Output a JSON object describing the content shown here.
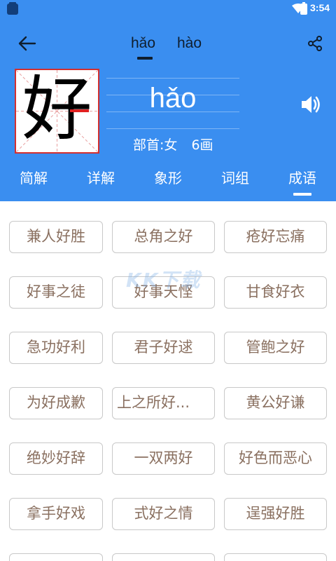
{
  "status_bar": {
    "time": "3:54",
    "icons": [
      "app-icon",
      "wifi-icon",
      "battery-icon"
    ]
  },
  "header": {
    "pinyin_tabs": [
      {
        "label": "hǎo",
        "selected": true
      },
      {
        "label": "hào",
        "selected": false
      }
    ],
    "character": "好",
    "pinyin": "hǎo",
    "radical_label": "部首:女",
    "stroke_count_label": "6画",
    "colors": {
      "background": "#3a8ef0",
      "char_border": "#d33030",
      "highlight_stroke": "#e02020"
    }
  },
  "tabs": [
    {
      "label": "简解",
      "selected": false
    },
    {
      "label": "详解",
      "selected": false
    },
    {
      "label": "象形",
      "selected": false
    },
    {
      "label": "词组",
      "selected": false
    },
    {
      "label": "成语",
      "selected": true
    }
  ],
  "idioms": [
    "兼人好胜",
    "总角之好",
    "疮好忘痛",
    "好事之徒",
    "好事天悭",
    "甘食好衣",
    "急功好利",
    "君子好逑",
    "管鲍之好",
    "为好成歉",
    "上之所好...",
    "黄公好谦",
    "绝妙好辞",
    "一双两好",
    "好色而恶心",
    "拿手好戏",
    "式好之情",
    "逞强好胜"
  ],
  "watermark": "KK下载"
}
